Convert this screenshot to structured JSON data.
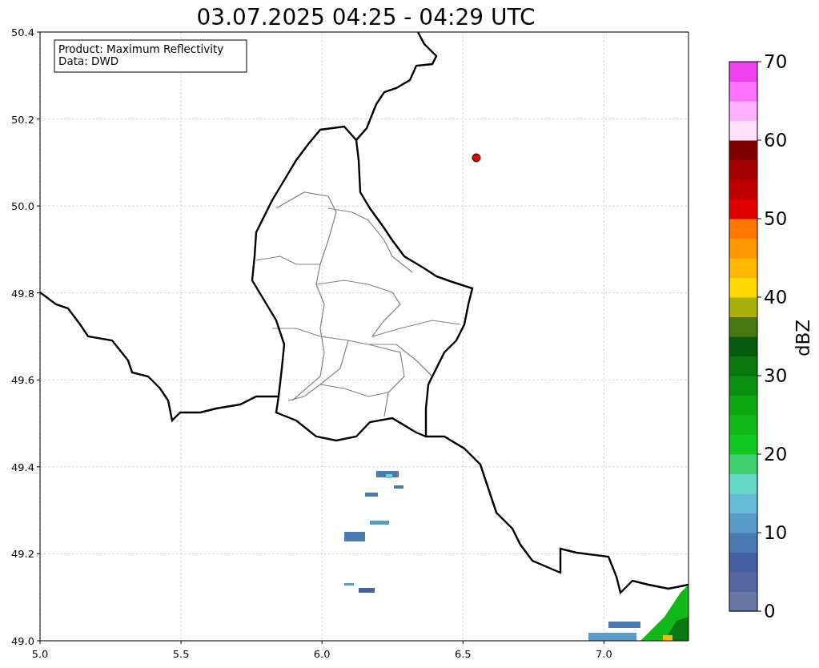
{
  "title": "03.07.2025 04:25 - 04:29 UTC",
  "annotation": [
    "Product: Maximum Reflectivity",
    "Data: DWD"
  ],
  "x_ticks": [
    "5.0",
    "5.5",
    "6.0",
    "6.5",
    "7.0"
  ],
  "y_ticks": [
    "50.4",
    "50.2",
    "50.0",
    "49.8",
    "49.6",
    "49.4",
    "49.2",
    "49.0"
  ],
  "colorbar": {
    "label": "dBZ",
    "ticks": [
      "70",
      "60",
      "50",
      "40",
      "30",
      "20",
      "10",
      "0"
    ],
    "bands": [
      {
        "color": "#6778a6"
      },
      {
        "color": "#5668a0"
      },
      {
        "color": "#4560a0"
      },
      {
        "color": "#4a7ab0"
      },
      {
        "color": "#5a9cc8"
      },
      {
        "color": "#66bcd8"
      },
      {
        "color": "#66d8c8"
      },
      {
        "color": "#40d070"
      },
      {
        "color": "#10c820"
      },
      {
        "color": "#10b818"
      },
      {
        "color": "#0ea814"
      },
      {
        "color": "#0c9010"
      },
      {
        "color": "#0a7810"
      },
      {
        "color": "#085c10"
      },
      {
        "color": "#4a7810"
      },
      {
        "color": "#a8b008"
      },
      {
        "color": "#ffd800"
      },
      {
        "color": "#ffb800"
      },
      {
        "color": "#ff9800"
      },
      {
        "color": "#ff7800"
      },
      {
        "color": "#e00000"
      },
      {
        "color": "#c00000"
      },
      {
        "color": "#a00000"
      },
      {
        "color": "#800000"
      },
      {
        "color": "#ffe0ff"
      },
      {
        "color": "#ffb0ff"
      },
      {
        "color": "#ff70ff"
      },
      {
        "color": "#f040f0"
      }
    ]
  }
}
